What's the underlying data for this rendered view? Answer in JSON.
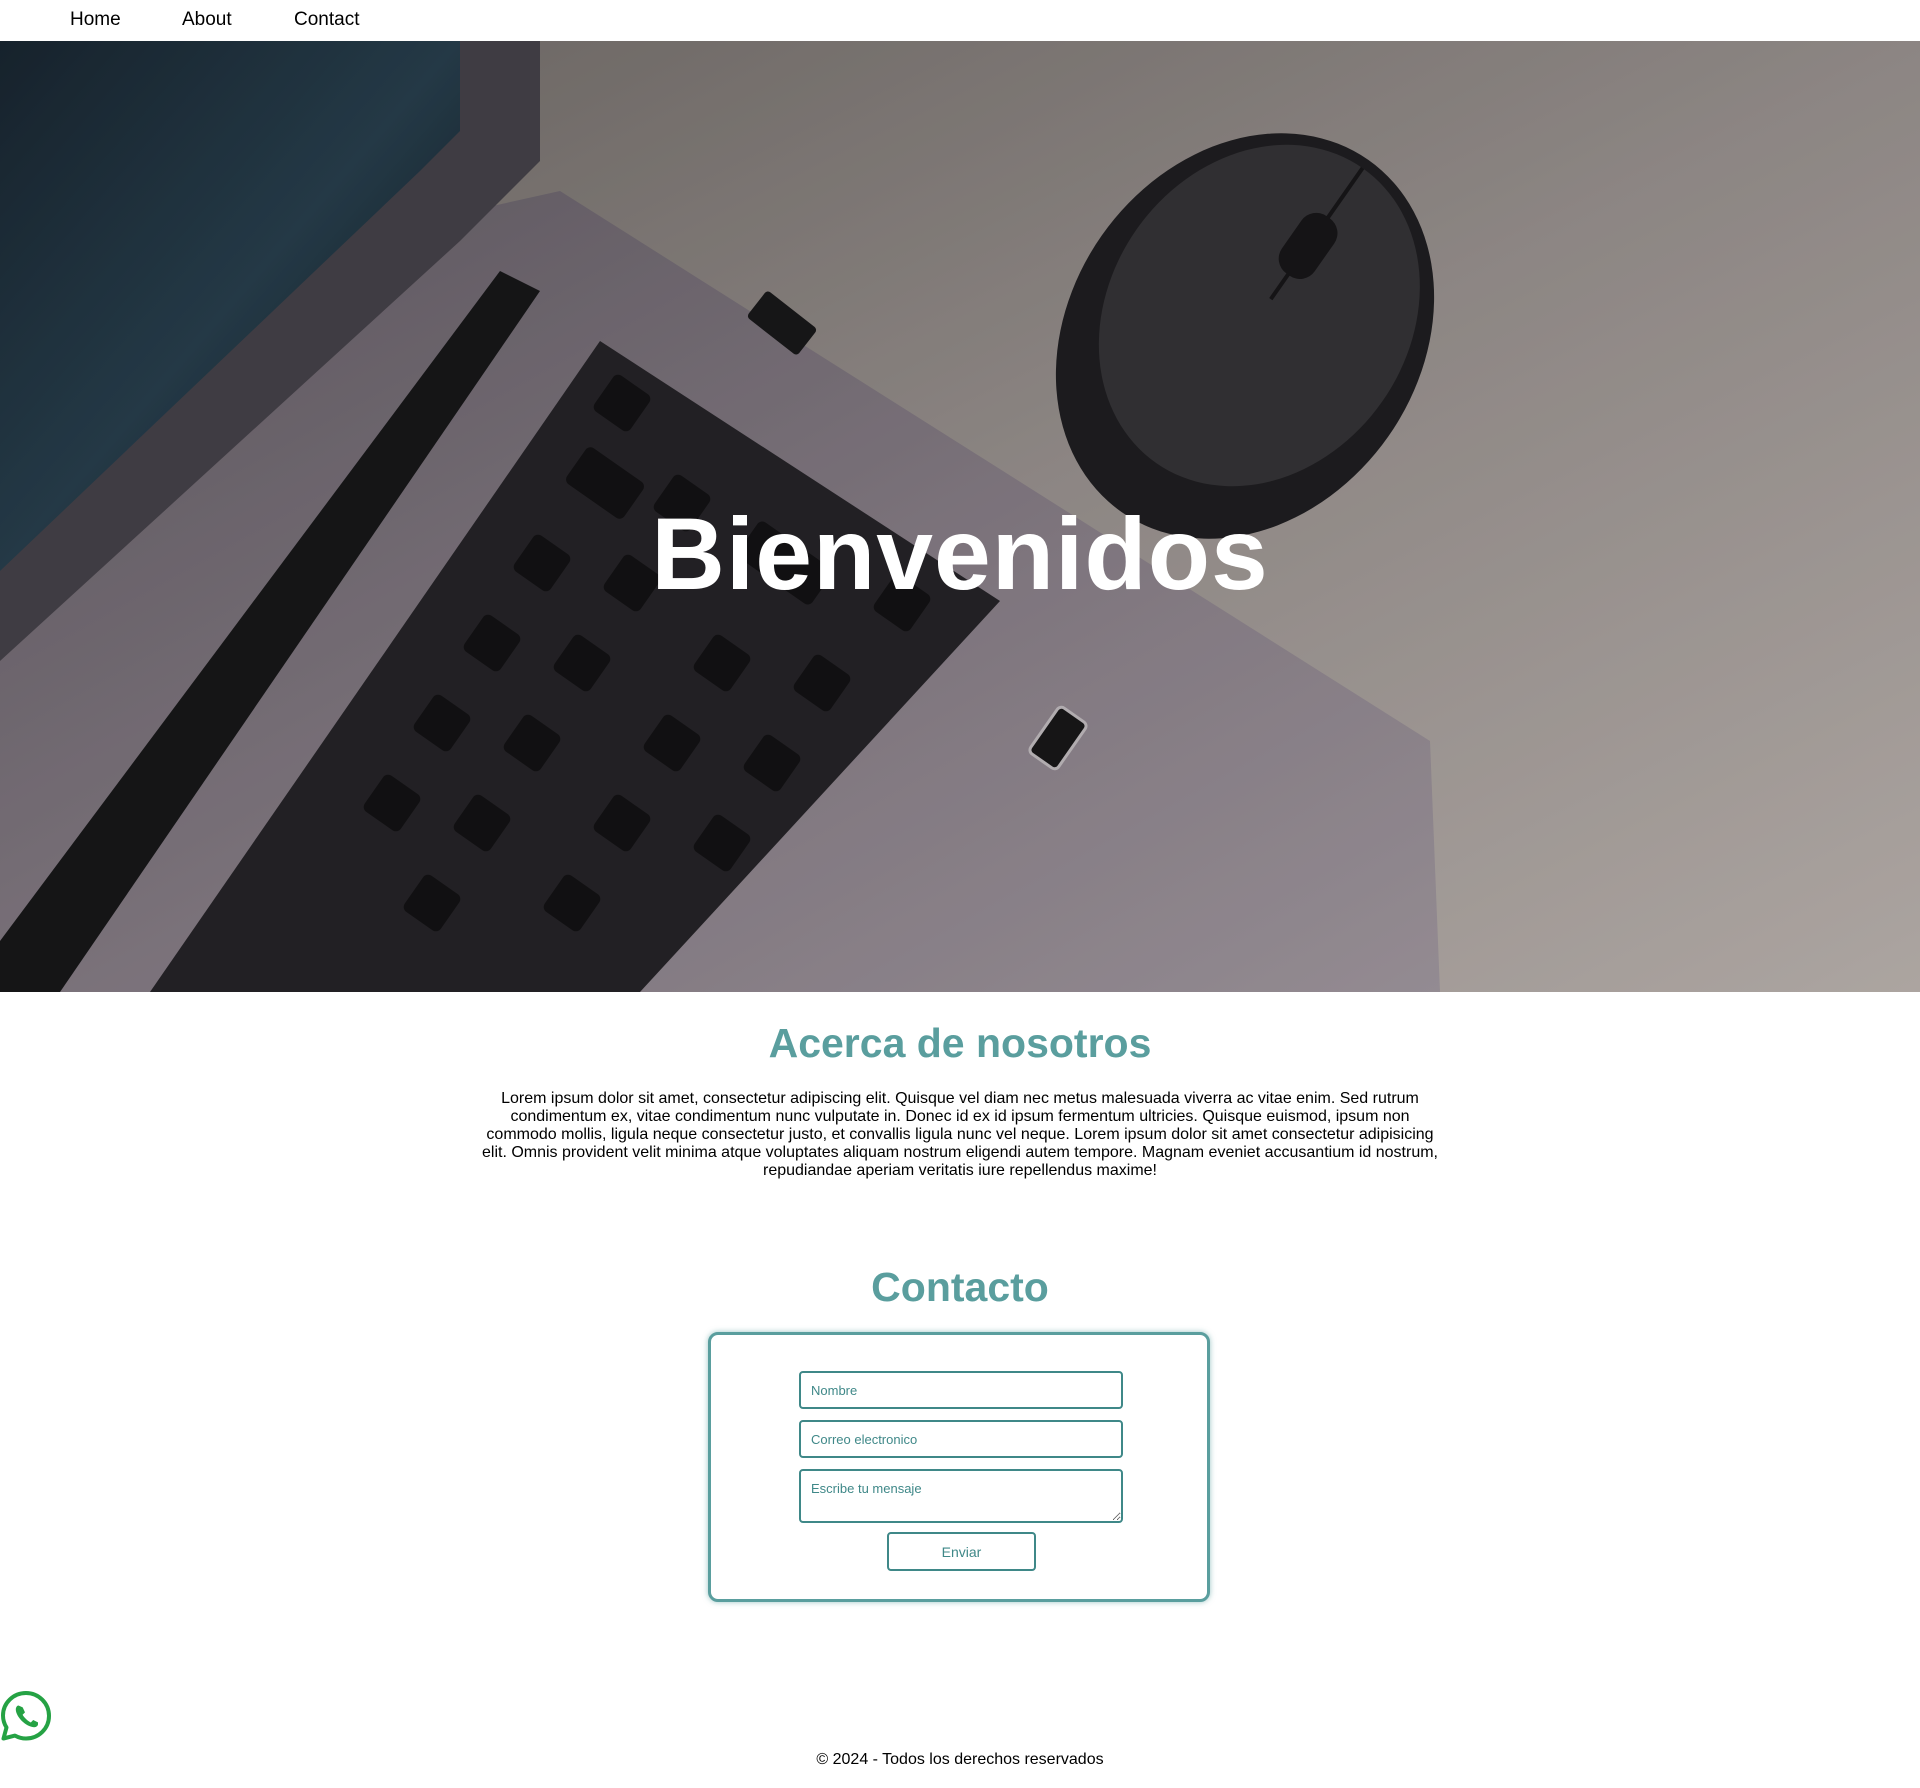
{
  "nav": {
    "links": [
      {
        "label": "Home"
      },
      {
        "label": "About"
      },
      {
        "label": "Contact"
      }
    ]
  },
  "hero": {
    "title": "Bienvenidos"
  },
  "about": {
    "title": "Acerca de nosotros",
    "text": "Lorem ipsum dolor sit amet, consectetur adipiscing elit. Quisque vel diam nec metus malesuada viverra ac vitae enim. Sed rutrum condimentum ex, vitae condimentum nunc vulputate in. Donec id ex id ipsum fermentum ultricies. Quisque euismod, ipsum non commodo mollis, ligula neque consectetur justo, et convallis ligula nunc vel neque. Lorem ipsum dolor sit amet consectetur adipisicing elit. Omnis provident velit minima atque voluptates aliquam nostrum eligendi autem tempore. Magnam eveniet accusantium id nostrum, repudiandae aperiam veritatis iure repellendus maxime!"
  },
  "contact": {
    "title": "Contacto",
    "form": {
      "name_placeholder": "Nombre",
      "email_placeholder": "Correo electronico",
      "message_placeholder": "Escribe tu mensaje",
      "submit_label": "Enviar"
    }
  },
  "whatsapp": {
    "icon": "whatsapp-icon",
    "color": "#25a244"
  },
  "footer": {
    "text": "© 2024 - Todos los derechos reservados"
  },
  "colors": {
    "accent": "#5a9e9e",
    "field_border": "#3f8888"
  }
}
